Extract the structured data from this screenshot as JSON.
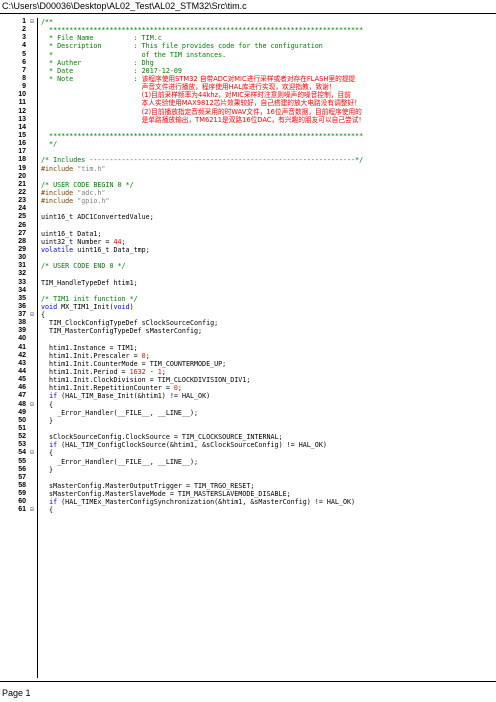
{
  "path": "C:\\Users\\D00036\\Desktop\\AL02_Test\\AL02_STM32\\Src\\tim.c",
  "page_label": "Page 1",
  "lines": [
    {
      "n": "1",
      "fold": "⊟",
      "segs": [
        {
          "t": "/**",
          "c": "comment"
        }
      ]
    },
    {
      "n": "2",
      "fold": "",
      "segs": [
        {
          "t": "  ******************************************************************************",
          "c": "comment"
        }
      ]
    },
    {
      "n": "3",
      "fold": "",
      "segs": [
        {
          "t": "  * File Name          : TIM.c",
          "c": "comment"
        }
      ]
    },
    {
      "n": "4",
      "fold": "",
      "segs": [
        {
          "t": "  * Description        : This file provides code for the configuration",
          "c": "comment"
        }
      ]
    },
    {
      "n": "5",
      "fold": "",
      "segs": [
        {
          "t": "  *                      of the TIM instances.",
          "c": "comment"
        }
      ]
    },
    {
      "n": "6",
      "fold": "",
      "segs": [
        {
          "t": "  * Auther             : Dhg",
          "c": "comment"
        }
      ]
    },
    {
      "n": "7",
      "fold": "",
      "segs": [
        {
          "t": "  * Date               : 2017-12-09",
          "c": "comment"
        }
      ]
    },
    {
      "n": "8",
      "fold": "",
      "segs": [
        {
          "t": "  * Note               : ",
          "c": "comment"
        },
        {
          "t": "该程序使用STM32 自带ADC对MIC进行采样或者对存在FLASH里的提提",
          "c": "cjk"
        }
      ]
    },
    {
      "n": "9",
      "fold": "",
      "segs": [
        {
          "t": "                         ",
          "c": "comment"
        },
        {
          "t": "声音文件进行播放，程序使用HAL库进行实现，欢迎指教，致谢！",
          "c": "cjk"
        }
      ]
    },
    {
      "n": "10",
      "fold": "",
      "segs": [
        {
          "t": "                         ",
          "c": "comment"
        },
        {
          "t": "(1)目前采样频率为44khz，对MIC采样时注意则噪声的噪音控制，目前",
          "c": "cjk"
        }
      ]
    },
    {
      "n": "11",
      "fold": "",
      "segs": [
        {
          "t": "                         ",
          "c": "comment"
        },
        {
          "t": "本人实验使用MAX9812芯片效果较好，自己搭建的放大电路没有调整好！",
          "c": "cjk"
        }
      ]
    },
    {
      "n": "12",
      "fold": "",
      "segs": [
        {
          "t": "                         ",
          "c": "comment"
        },
        {
          "t": "(2)目前播放指定音频采用的时WAV文件，16位声音数据，目前程序使用的",
          "c": "cjk"
        }
      ]
    },
    {
      "n": "13",
      "fold": "",
      "segs": [
        {
          "t": "                         ",
          "c": "comment"
        },
        {
          "t": "是单路播放输出，TM6211是双路16位DAC，有兴趣的朋友可以自己尝试！",
          "c": "cjk"
        }
      ]
    },
    {
      "n": "14",
      "fold": "",
      "segs": [
        {
          "t": "",
          "c": "default"
        }
      ]
    },
    {
      "n": "15",
      "fold": "",
      "segs": [
        {
          "t": "  ******************************************************************************",
          "c": "comment"
        }
      ]
    },
    {
      "n": "16",
      "fold": "",
      "segs": [
        {
          "t": "  */",
          "c": "comment"
        }
      ]
    },
    {
      "n": "17",
      "fold": "",
      "segs": [
        {
          "t": "",
          "c": "default"
        }
      ]
    },
    {
      "n": "18",
      "fold": "",
      "segs": [
        {
          "t": "/* Includes ------------------------------------------------------------------*/",
          "c": "comment"
        }
      ]
    },
    {
      "n": "19",
      "fold": "",
      "segs": [
        {
          "t": "#include ",
          "c": "preproc"
        },
        {
          "t": "\"tim.h\"",
          "c": "string"
        }
      ]
    },
    {
      "n": "20",
      "fold": "",
      "segs": [
        {
          "t": "",
          "c": "default"
        }
      ]
    },
    {
      "n": "21",
      "fold": "",
      "segs": [
        {
          "t": "/* USER CODE BEGIN 0 */",
          "c": "comment"
        }
      ]
    },
    {
      "n": "22",
      "fold": "",
      "segs": [
        {
          "t": "#include ",
          "c": "preproc"
        },
        {
          "t": "\"adc.h\"",
          "c": "string"
        }
      ]
    },
    {
      "n": "23",
      "fold": "",
      "segs": [
        {
          "t": "#include ",
          "c": "preproc"
        },
        {
          "t": "\"gpio.h\"",
          "c": "string"
        }
      ]
    },
    {
      "n": "24",
      "fold": "",
      "segs": [
        {
          "t": "",
          "c": "default"
        }
      ]
    },
    {
      "n": "25",
      "fold": "",
      "segs": [
        {
          "t": "uint16_t ADC1ConvertedValue;",
          "c": "default"
        }
      ]
    },
    {
      "n": "26",
      "fold": "",
      "segs": [
        {
          "t": "",
          "c": "default"
        }
      ]
    },
    {
      "n": "27",
      "fold": "",
      "segs": [
        {
          "t": "uint16_t Data1;",
          "c": "default"
        }
      ]
    },
    {
      "n": "28",
      "fold": "",
      "segs": [
        {
          "t": "uint32_t Number = ",
          "c": "default"
        },
        {
          "t": "44",
          "c": "number"
        },
        {
          "t": ";",
          "c": "default"
        }
      ]
    },
    {
      "n": "29",
      "fold": "",
      "segs": [
        {
          "t": "volatile",
          "c": "keyword"
        },
        {
          "t": " uint16_t Data_tmp;",
          "c": "default"
        }
      ]
    },
    {
      "n": "30",
      "fold": "",
      "segs": [
        {
          "t": "",
          "c": "default"
        }
      ]
    },
    {
      "n": "31",
      "fold": "",
      "segs": [
        {
          "t": "/* USER CODE END 0 */",
          "c": "comment"
        }
      ]
    },
    {
      "n": "32",
      "fold": "",
      "segs": [
        {
          "t": "",
          "c": "default"
        }
      ]
    },
    {
      "n": "33",
      "fold": "",
      "segs": [
        {
          "t": "TIM_HandleTypeDef htim1;",
          "c": "default"
        }
      ]
    },
    {
      "n": "34",
      "fold": "",
      "segs": [
        {
          "t": "",
          "c": "default"
        }
      ]
    },
    {
      "n": "35",
      "fold": "",
      "segs": [
        {
          "t": "/* TIM1 init function */",
          "c": "comment"
        }
      ]
    },
    {
      "n": "36",
      "fold": "",
      "segs": [
        {
          "t": "void",
          "c": "keyword"
        },
        {
          "t": " MX_TIM1_Init(",
          "c": "default"
        },
        {
          "t": "void",
          "c": "keyword"
        },
        {
          "t": ")",
          "c": "default"
        }
      ]
    },
    {
      "n": "37",
      "fold": "⊟",
      "segs": [
        {
          "t": "{",
          "c": "default"
        }
      ]
    },
    {
      "n": "38",
      "fold": "",
      "segs": [
        {
          "t": "  TIM_ClockConfigTypeDef sClockSourceConfig;",
          "c": "default"
        }
      ]
    },
    {
      "n": "39",
      "fold": "",
      "segs": [
        {
          "t": "  TIM_MasterConfigTypeDef sMasterConfig;",
          "c": "default"
        }
      ]
    },
    {
      "n": "40",
      "fold": "",
      "segs": [
        {
          "t": "",
          "c": "default"
        }
      ]
    },
    {
      "n": "41",
      "fold": "",
      "segs": [
        {
          "t": "  htim1.Instance = TIM1;",
          "c": "default"
        }
      ]
    },
    {
      "n": "42",
      "fold": "",
      "segs": [
        {
          "t": "  htim1.Init.Prescaler = ",
          "c": "default"
        },
        {
          "t": "0",
          "c": "number"
        },
        {
          "t": ";",
          "c": "default"
        }
      ]
    },
    {
      "n": "43",
      "fold": "",
      "segs": [
        {
          "t": "  htim1.Init.CounterMode = TIM_COUNTERMODE_UP;",
          "c": "default"
        }
      ]
    },
    {
      "n": "44",
      "fold": "",
      "segs": [
        {
          "t": "  htim1.Init.Period = ",
          "c": "default"
        },
        {
          "t": "1632",
          "c": "number"
        },
        {
          "t": " - ",
          "c": "default"
        },
        {
          "t": "1",
          "c": "number"
        },
        {
          "t": ";",
          "c": "default"
        }
      ]
    },
    {
      "n": "45",
      "fold": "",
      "segs": [
        {
          "t": "  htim1.Init.ClockDivision = TIM_CLOCKDIVISION_DIV1;",
          "c": "default"
        }
      ]
    },
    {
      "n": "46",
      "fold": "",
      "segs": [
        {
          "t": "  htim1.Init.RepetitionCounter = ",
          "c": "default"
        },
        {
          "t": "0",
          "c": "number"
        },
        {
          "t": ";",
          "c": "default"
        }
      ]
    },
    {
      "n": "47",
      "fold": "",
      "segs": [
        {
          "t": "  ",
          "c": "default"
        },
        {
          "t": "if",
          "c": "keyword"
        },
        {
          "t": " (HAL_TIM_Base_Init(&htim1) != HAL_OK)",
          "c": "default"
        }
      ]
    },
    {
      "n": "48",
      "fold": "⊟",
      "segs": [
        {
          "t": "  {",
          "c": "default"
        }
      ]
    },
    {
      "n": "49",
      "fold": "",
      "segs": [
        {
          "t": "    _Error_Handler(__FILE__, __LINE__);",
          "c": "default"
        }
      ]
    },
    {
      "n": "50",
      "fold": "",
      "segs": [
        {
          "t": "  }",
          "c": "default"
        }
      ]
    },
    {
      "n": "51",
      "fold": "",
      "segs": [
        {
          "t": "",
          "c": "default"
        }
      ]
    },
    {
      "n": "52",
      "fold": "",
      "segs": [
        {
          "t": "  sClockSourceConfig.ClockSource = TIM_CLOCKSOURCE_INTERNAL;",
          "c": "default"
        }
      ]
    },
    {
      "n": "53",
      "fold": "",
      "segs": [
        {
          "t": "  ",
          "c": "default"
        },
        {
          "t": "if",
          "c": "keyword"
        },
        {
          "t": " (HAL_TIM_ConfigClockSource(&htim1, &sClockSourceConfig) != HAL_OK)",
          "c": "default"
        }
      ]
    },
    {
      "n": "54",
      "fold": "⊟",
      "segs": [
        {
          "t": "  {",
          "c": "default"
        }
      ]
    },
    {
      "n": "55",
      "fold": "",
      "segs": [
        {
          "t": "    _Error_Handler(__FILE__, __LINE__);",
          "c": "default"
        }
      ]
    },
    {
      "n": "56",
      "fold": "",
      "segs": [
        {
          "t": "  }",
          "c": "default"
        }
      ]
    },
    {
      "n": "57",
      "fold": "",
      "segs": [
        {
          "t": "",
          "c": "default"
        }
      ]
    },
    {
      "n": "58",
      "fold": "",
      "segs": [
        {
          "t": "  sMasterConfig.MasterOutputTrigger = TIM_TRGO_RESET;",
          "c": "default"
        }
      ]
    },
    {
      "n": "59",
      "fold": "",
      "segs": [
        {
          "t": "  sMasterConfig.MasterSlaveMode = TIM_MASTERSLAVEMODE_DISABLE;",
          "c": "default"
        }
      ]
    },
    {
      "n": "60",
      "fold": "",
      "segs": [
        {
          "t": "  ",
          "c": "default"
        },
        {
          "t": "if",
          "c": "keyword"
        },
        {
          "t": " (HAL_TIMEx_MasterConfigSynchronization(&htim1, &sMasterConfig) != HAL_OK)",
          "c": "default"
        }
      ]
    },
    {
      "n": "61",
      "fold": "⊟",
      "segs": [
        {
          "t": "  {",
          "c": "default"
        }
      ]
    }
  ]
}
